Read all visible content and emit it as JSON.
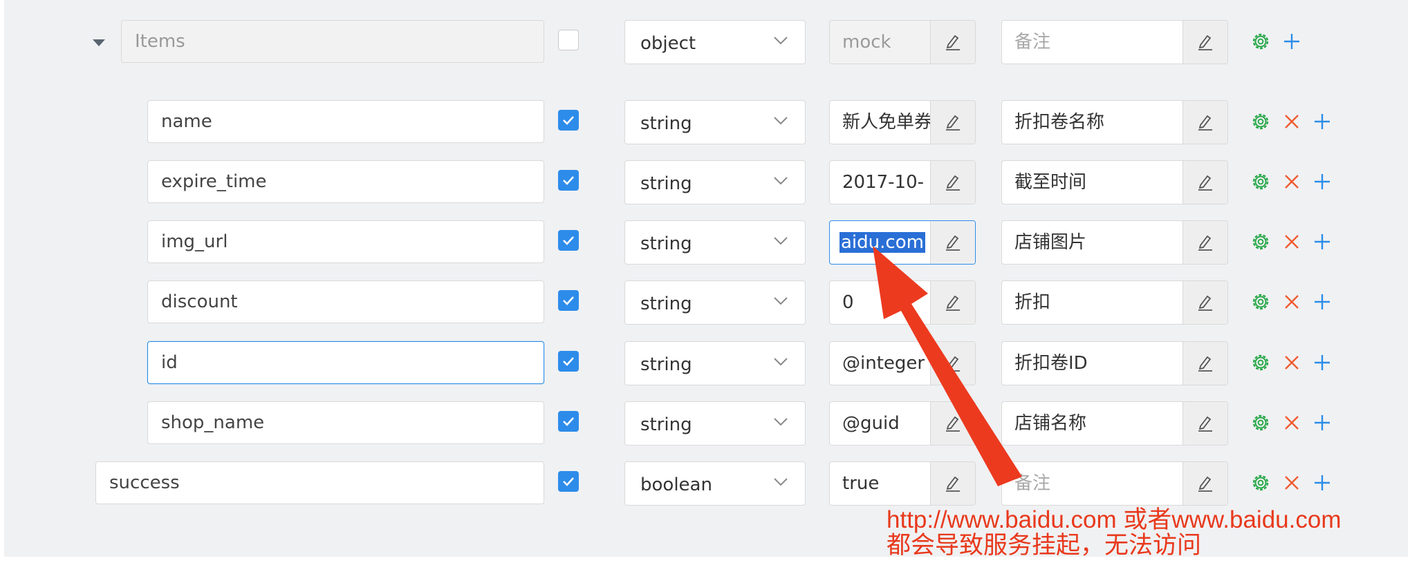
{
  "root": {
    "name": "Items",
    "type": "object",
    "mock": "mock",
    "desc_placeholder": "备注",
    "checked": false
  },
  "fields": [
    {
      "name": "name",
      "type": "string",
      "mock": "新人免单券",
      "desc": "折扣卷名称",
      "checked": true
    },
    {
      "name": "expire_time",
      "type": "string",
      "mock": "2017-10-",
      "desc": "截至时间",
      "checked": true
    },
    {
      "name": "img_url",
      "type": "string",
      "mock": "aidu.com",
      "desc": "店铺图片",
      "checked": true
    },
    {
      "name": "discount",
      "type": "string",
      "mock": "0",
      "desc": "折扣",
      "checked": true
    },
    {
      "name": "id",
      "type": "string",
      "mock": "@integer",
      "desc": "折扣卷ID",
      "checked": true
    },
    {
      "name": "shop_name",
      "type": "string",
      "mock": "@guid",
      "desc": "店铺名称",
      "checked": true
    }
  ],
  "success": {
    "name": "success",
    "type": "boolean",
    "mock": "true",
    "desc_placeholder": "备注",
    "checked": true
  },
  "annotation": {
    "line1": "http://www.baidu.com 或者www.baidu.com",
    "line2": "都会导致服务挂起，无法访问"
  },
  "colors": {
    "accent_blue": "#2d8cea",
    "settings_green": "#2aa84a",
    "delete_red": "#f05a2e",
    "add_blue": "#2a8de8",
    "annotation_red": "#e8391c"
  },
  "icons": [
    "caret-down-icon",
    "checkbox-check-icon",
    "chevron-down-icon",
    "edit-pencil-icon",
    "settings-gear-icon",
    "delete-x-icon",
    "add-plus-icon",
    "annotation-arrow"
  ]
}
